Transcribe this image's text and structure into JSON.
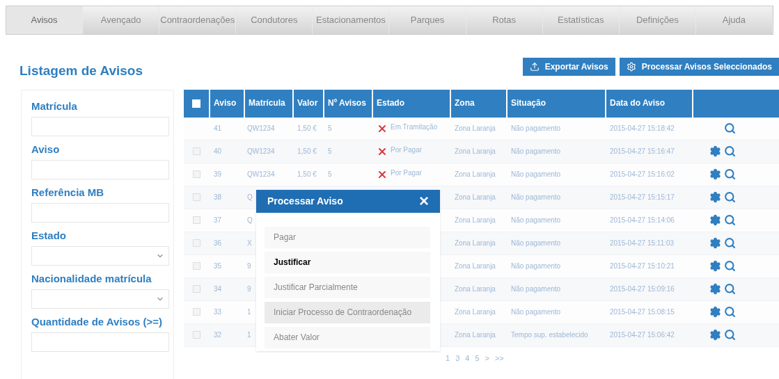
{
  "nav": [
    {
      "label": "Avisos",
      "selected": true
    },
    {
      "label": "Avençado",
      "selected": false
    },
    {
      "label": "Contraordenações",
      "selected": false
    },
    {
      "label": "Condutores",
      "selected": false
    },
    {
      "label": "Estacionamentos",
      "selected": false
    },
    {
      "label": "Parques",
      "selected": false
    },
    {
      "label": "Rotas",
      "selected": false
    },
    {
      "label": "Estatísticas",
      "selected": false
    },
    {
      "label": "Definições",
      "selected": false
    },
    {
      "label": "Ajuda",
      "selected": false
    }
  ],
  "title": "Listagem de Avisos",
  "actions": [
    {
      "kind": "export",
      "label": "Exportar Avisos"
    },
    {
      "kind": "process",
      "label": "Processar Avisos Seleccionados"
    }
  ],
  "filters": [
    {
      "label": "Matrícula",
      "kind": "text"
    },
    {
      "label": "Aviso",
      "kind": "text"
    },
    {
      "label": "Referência MB",
      "kind": "text"
    },
    {
      "label": "Estado",
      "kind": "select"
    },
    {
      "label": "Nacionalidade matrícula",
      "kind": "select"
    },
    {
      "label": "Quantidade de Avisos (>=)",
      "kind": "text"
    }
  ],
  "table": {
    "columns": [
      "Aviso",
      "Matrícula",
      "Valor",
      "Nº Avisos",
      "Estado",
      "Zona",
      "Situação",
      "Data do Aviso"
    ],
    "all_checked": false,
    "rows": [
      {
        "checkbox": false,
        "aviso": "41",
        "matricula": "QW1234",
        "valor": "1,50 €",
        "n": "5",
        "estado": "Em Tramitação",
        "zona": "Zona Laranja",
        "situacao": "Não pagamento",
        "data": "2015-04-27 15:18:42",
        "gear": false
      },
      {
        "checkbox": true,
        "aviso": "40",
        "matricula": "QW1234",
        "valor": "1,50 €",
        "n": "5",
        "estado": "Por Pagar",
        "zona": "Zona Laranja",
        "situacao": "Não pagamento",
        "data": "2015-04-27 15:16:47",
        "gear": true
      },
      {
        "checkbox": true,
        "aviso": "39",
        "matricula": "QW1234",
        "valor": "1,50 €",
        "n": "5",
        "estado": "Por Pagar",
        "zona": "Zona Laranja",
        "situacao": "Não pagamento",
        "data": "2015-04-27 15:16:02",
        "gear": true
      },
      {
        "checkbox": true,
        "aviso": "38",
        "matricula": "Q",
        "zona": "Zona Laranja",
        "situacao": "Não pagamento",
        "data": "2015-04-27 15:15:17",
        "gear": true
      },
      {
        "checkbox": true,
        "aviso": "37",
        "matricula": "Q",
        "zona": "Zona Laranja",
        "situacao": "Não pagamento",
        "data": "2015-04-27 15:14:06",
        "gear": true
      },
      {
        "checkbox": true,
        "aviso": "36",
        "matricula": "X",
        "zona": "Zona Laranja",
        "situacao": "Não pagamento",
        "data": "2015-04-27 15:11:03",
        "gear": true
      },
      {
        "checkbox": true,
        "aviso": "35",
        "matricula": "9",
        "zona": "Zona Laranja",
        "situacao": "Não pagamento",
        "data": "2015-04-27 15:10:21",
        "gear": true
      },
      {
        "checkbox": true,
        "aviso": "34",
        "matricula": "9",
        "zona": "Zona Laranja",
        "situacao": "Não pagamento",
        "data": "2015-04-27 15:09:16",
        "gear": true
      },
      {
        "checkbox": true,
        "aviso": "33",
        "matricula": "1",
        "zona": "Zona Laranja",
        "situacao": "Não pagamento",
        "data": "2015-04-27 15:08:15",
        "gear": true
      },
      {
        "checkbox": true,
        "aviso": "32",
        "matricula": "1",
        "zona": "Zona Laranja",
        "situacao": "Tempo sup. estabelecido",
        "data": "2015-04-27 15:06:42",
        "gear": true
      }
    ]
  },
  "pagination": [
    "1",
    "3",
    "4",
    "5",
    ">",
    ">>"
  ],
  "modal": {
    "title": "Processar Aviso",
    "close": "×",
    "options": [
      {
        "label": "Pagar",
        "selected": false,
        "hover": false
      },
      {
        "label": "Justificar",
        "selected": true,
        "hover": false
      },
      {
        "label": "Justificar Parcialmente",
        "selected": false,
        "hover": false
      },
      {
        "label": "Iniciar Processo de Contraordenação",
        "selected": false,
        "hover": true
      },
      {
        "label": "Abater Valor",
        "selected": false,
        "hover": false
      }
    ]
  }
}
